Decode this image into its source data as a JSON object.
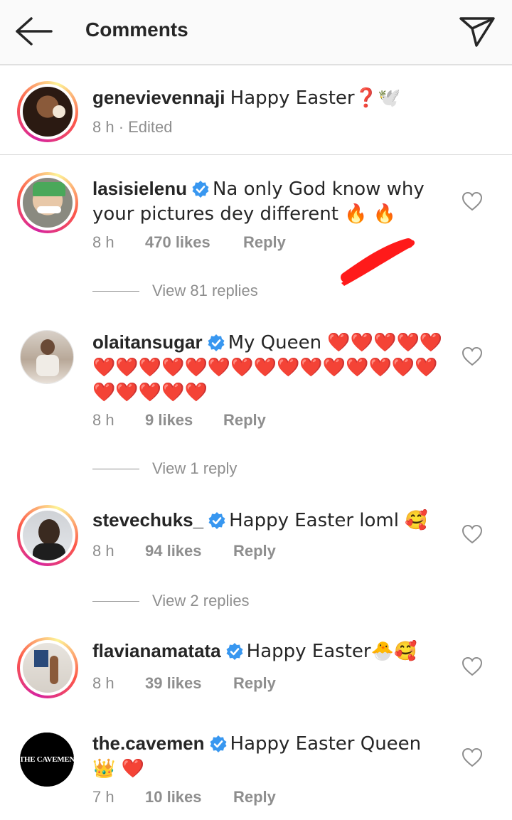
{
  "header": {
    "title": "Comments",
    "back_icon": "arrow-left-icon",
    "send_icon": "paper-plane-icon"
  },
  "caption": {
    "username": "genevievennaji",
    "text": "Happy Easter❓🕊️",
    "meta": "8 h · Edited"
  },
  "comments": [
    {
      "username": "lasisielenu",
      "verified": true,
      "text": "Na only God know why your pictures dey  different 🔥 🔥",
      "time": "8 h",
      "likes": "470 likes",
      "reply": "Reply",
      "view_replies": "View 81 replies"
    },
    {
      "username": "olaitansugar",
      "verified": true,
      "text": "My Queen ❤️❤️❤️❤️❤️❤️❤️❤️❤️❤️❤️❤️❤️❤️❤️❤️❤️❤️❤️❤️❤️❤️❤️❤️❤️",
      "time": "8 h",
      "likes": "9 likes",
      "reply": "Reply",
      "view_replies": "View 1 reply"
    },
    {
      "username": "stevechuks_",
      "verified": true,
      "text": "Happy Easter loml 🥰",
      "time": "8 h",
      "likes": "94 likes",
      "reply": "Reply",
      "view_replies": "View 2 replies"
    },
    {
      "username": "flavianamatata",
      "verified": true,
      "text": "Happy Easter🐣🥰",
      "time": "8 h",
      "likes": "39 likes",
      "reply": "Reply"
    },
    {
      "username": "the.cavemen",
      "verified": true,
      "text": "Happy Easter Queen 👑 ❤️",
      "time": "7 h",
      "likes": "10 likes",
      "reply": "Reply",
      "avatar_text": "THE CAVEMEN"
    }
  ],
  "colors": {
    "verified": "#3897f0",
    "heart_red": "#e0142b",
    "muted": "#8e8e8e",
    "text": "#262626",
    "scribble": "#ff1a1a"
  }
}
